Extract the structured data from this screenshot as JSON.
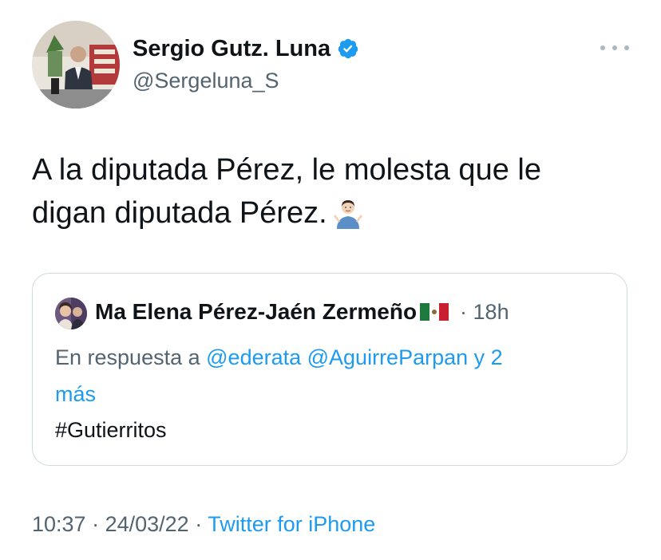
{
  "author": {
    "name": "Sergio Gutz. Luna",
    "handle": "@Sergeluna_S",
    "verified": true,
    "avatar_icon": "profile-photo"
  },
  "menu": {
    "icon": "more-options-icon"
  },
  "tweet": {
    "text_line1": "A la diputada Pérez, le molesta que le",
    "text_line2": "digan diputada Pérez.",
    "emoji": "person-shrugging-emoji"
  },
  "quoted_tweet": {
    "author_name": "Ma Elena Pérez-Jaén Zermeño",
    "flag_emoji": "mexico-flag",
    "time": "· 18h",
    "reply_prefix": "En respuesta a",
    "reply_mentions_line1": "@ederata @AguirreParpan y 2",
    "reply_mentions_line2": "más",
    "text": "#Gutierritos"
  },
  "footer": {
    "time": "10:37",
    "separator1": " · ",
    "date": "24/03/22",
    "separator2": " · ",
    "source": "Twitter for iPhone"
  },
  "colors": {
    "link": "#1d9bf0",
    "secondary_text": "#536471",
    "primary_text": "#0f1419",
    "border": "#cfd9de"
  }
}
